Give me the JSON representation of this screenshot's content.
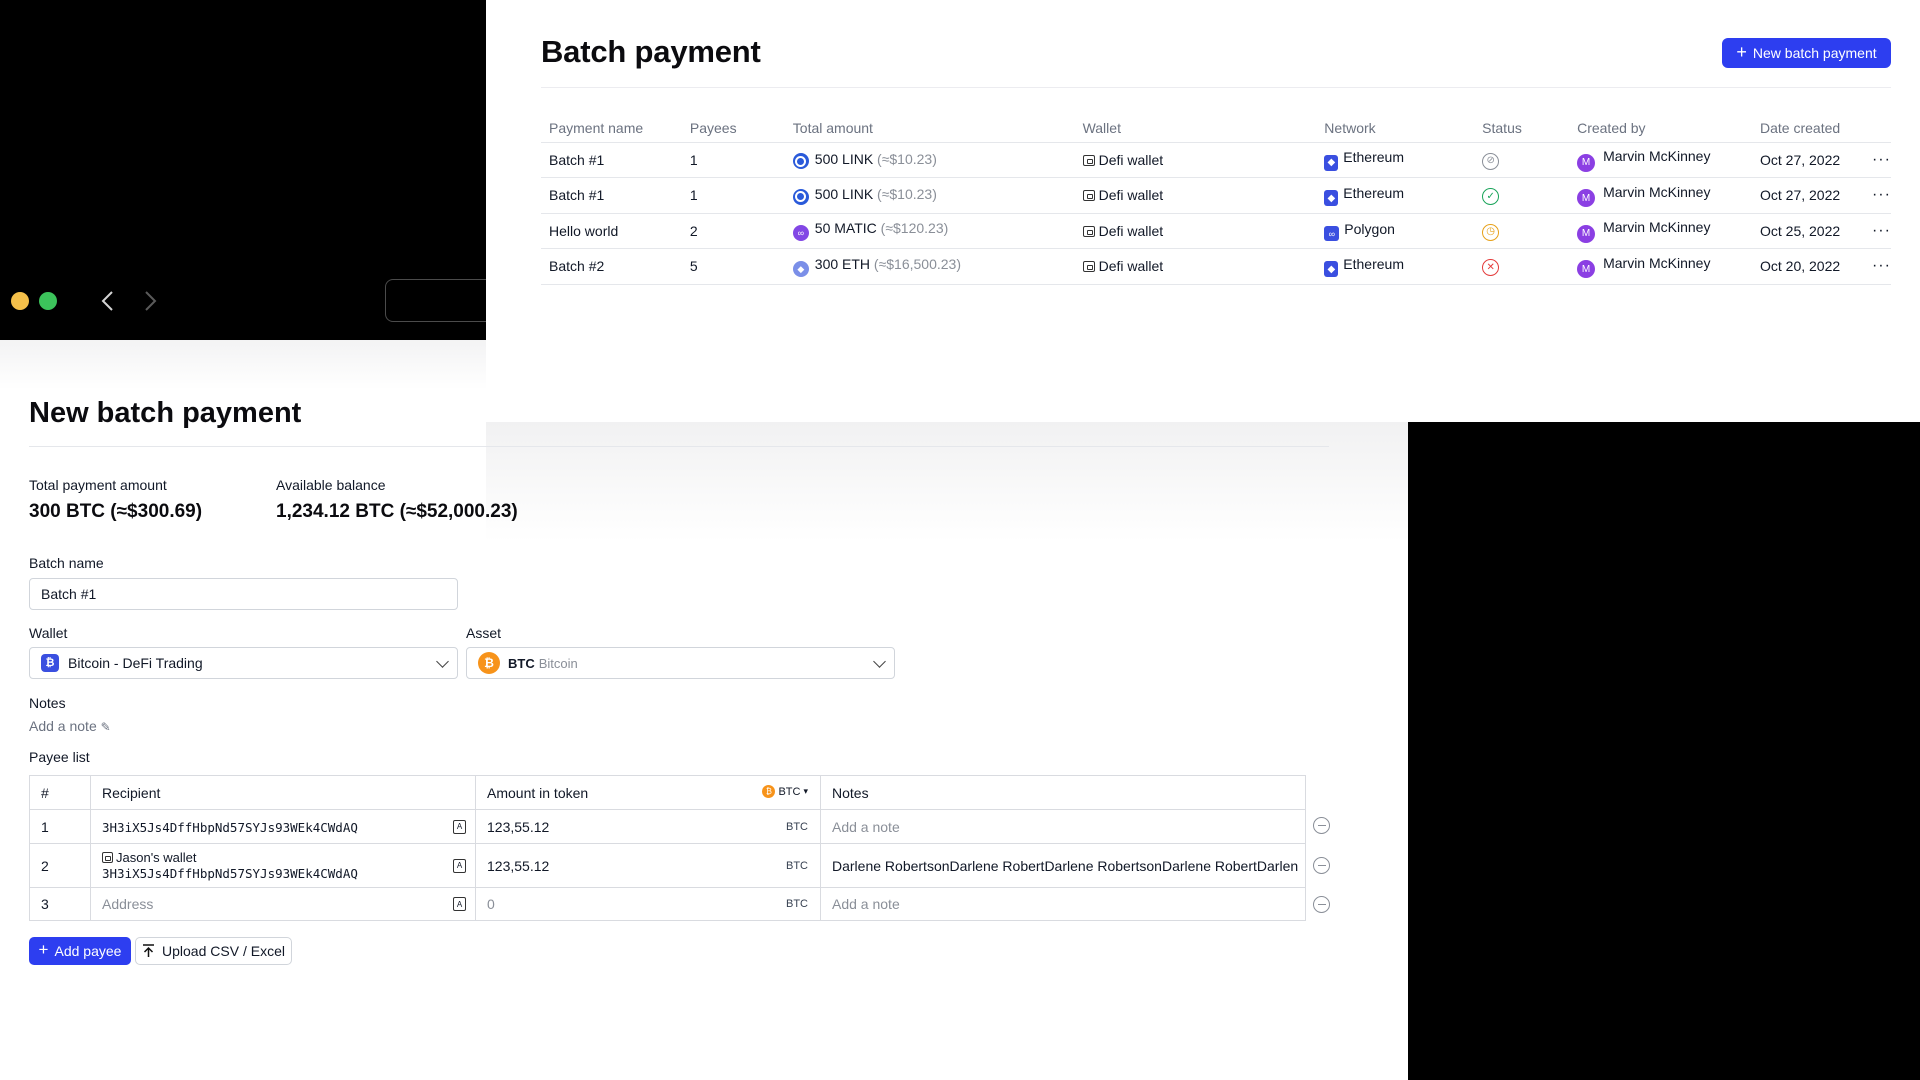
{
  "batch_list": {
    "title": "Batch payment",
    "new_button_label": "New batch payment",
    "columns": [
      "Payment name",
      "Payees",
      "Total amount",
      "Wallet",
      "Network",
      "Status",
      "Created by",
      "Date created"
    ],
    "rows": [
      {
        "name": "Batch #1",
        "payees": "1",
        "amount": "500 LINK",
        "approx": "(≈$10.23)",
        "coin": "link",
        "wallet": "Defi wallet",
        "network": "Ethereum",
        "status": "pending",
        "created_by": "Marvin McKinney",
        "avatar": "M",
        "date": "Oct 27, 2022"
      },
      {
        "name": "Batch #1",
        "payees": "1",
        "amount": "500 LINK",
        "approx": "(≈$10.23)",
        "coin": "link",
        "wallet": "Defi wallet",
        "network": "Ethereum",
        "status": "success",
        "created_by": "Marvin McKinney",
        "avatar": "M",
        "date": "Oct 27, 2022"
      },
      {
        "name": "Hello world",
        "payees": "2",
        "amount": "50 MATIC",
        "approx": "(≈$120.23)",
        "coin": "matic",
        "wallet": "Defi wallet",
        "network": "Polygon",
        "status": "waiting",
        "created_by": "Marvin McKinney",
        "avatar": "M",
        "date": "Oct 25, 2022"
      },
      {
        "name": "Batch #2",
        "payees": "5",
        "amount": "300 ETH",
        "approx": "(≈$16,500.23)",
        "coin": "eth",
        "wallet": "Defi wallet",
        "network": "Ethereum",
        "status": "failed",
        "created_by": "Marvin McKinney",
        "avatar": "M",
        "date": "Oct 20, 2022"
      }
    ]
  },
  "form": {
    "title": "New batch payment",
    "total_label": "Total payment amount",
    "total_value": "300 BTC (≈$300.69)",
    "balance_label": "Available balance",
    "balance_value": "1,234.12 BTC (≈$52,000.23)",
    "batch_name_label": "Batch name",
    "batch_name_value": "Batch #1",
    "wallet_label": "Wallet",
    "wallet_value": "Bitcoin - DeFi Trading",
    "asset_label": "Asset",
    "asset_symbol": "BTC",
    "asset_name": "Bitcoin",
    "notes_label": "Notes",
    "add_note_link": "Add a note",
    "payee_list_label": "Payee list",
    "payee_columns": {
      "num": "#",
      "recipient": "Recipient",
      "amount": "Amount in token",
      "token": "BTC",
      "notes": "Notes"
    },
    "payees": [
      {
        "num": "1",
        "wallet_name": "",
        "address": "3H3iX5Js4DffHbpNd57SYJs93WEk4CWdAQ",
        "amount": "123,55.12",
        "unit": "BTC",
        "note": "",
        "note_placeholder": "Add a note"
      },
      {
        "num": "2",
        "wallet_name": "Jason's wallet",
        "address": "3H3iX5Js4DffHbpNd57SYJs93WEk4CWdAQ",
        "amount": "123,55.12",
        "unit": "BTC",
        "note": "Darlene RobertsonDarlene RobertDarlene RobertsonDarlene RobertDarlen",
        "note_placeholder": ""
      },
      {
        "num": "3",
        "wallet_name": "",
        "address": "",
        "address_placeholder": "Address",
        "amount": "",
        "amount_placeholder": "0",
        "unit": "BTC",
        "note": "",
        "note_placeholder": "Add a note"
      }
    ],
    "add_payee_label": "Add payee",
    "upload_label": "Upload CSV / Excel"
  },
  "colors": {
    "accent": "#2d3ef0",
    "avatar": "#8b3fe3",
    "btc": "#f7931a"
  }
}
